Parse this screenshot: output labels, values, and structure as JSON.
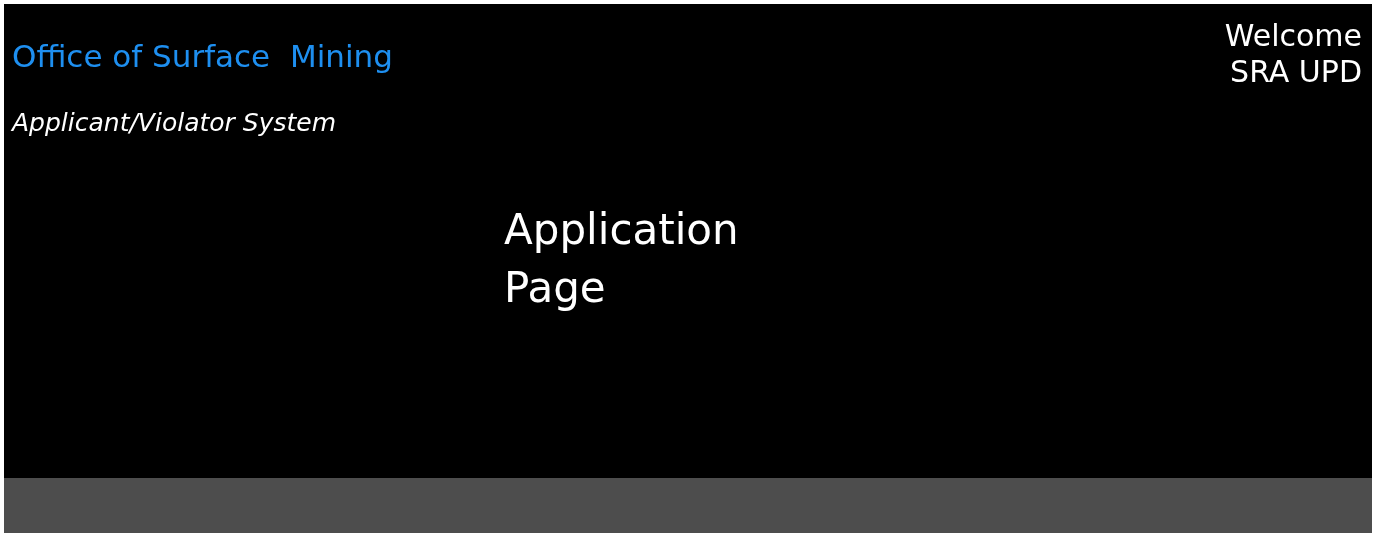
{
  "header": {
    "title": "Office of Surface  Mining",
    "subtitle": "Applicant/Violator System"
  },
  "user": {
    "greeting": "Welcome",
    "name": "SRA UPD"
  },
  "main": {
    "heading": "Application Page"
  }
}
